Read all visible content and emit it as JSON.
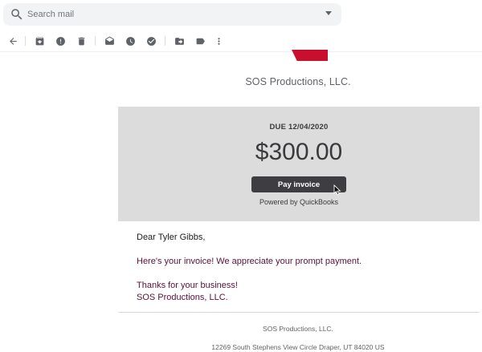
{
  "search": {
    "placeholder": "Search mail",
    "icon": "search-icon",
    "options_icon": "caret-down-icon"
  },
  "toolbar": {
    "back": "arrow-back-icon",
    "archive": "archive-icon",
    "spam": "report-spam-icon",
    "delete": "trash-icon",
    "mark_unread": "mark-unread-icon",
    "snooze": "snooze-icon",
    "add_task": "add-task-icon",
    "move_to": "move-to-icon",
    "label": "label-icon",
    "more": "more-vert-icon"
  },
  "email": {
    "company_header": "SOS Productions, LLC.",
    "invoice": {
      "due": "DUE 12/04/2020",
      "amount": "$300.00",
      "pay_button": "Pay invoice",
      "powered_by": "Powered by QuickBooks"
    },
    "message": {
      "greeting": "Dear Tyler Gibbs,",
      "body": "Here's your invoice! We appreciate your prompt payment.",
      "closing": "Thanks for your business!",
      "signature": "SOS Productions, LLC."
    },
    "footer": {
      "company": "SOS Productions, LLC.",
      "address": "12269 South Stephens View Circle Draper, UT 84020 US"
    }
  },
  "colors": {
    "brand_red": "#c8102e",
    "panel_gray": "#dcdcdd",
    "button_dark": "#3e3e42",
    "message_text": "#5b0f3a"
  }
}
